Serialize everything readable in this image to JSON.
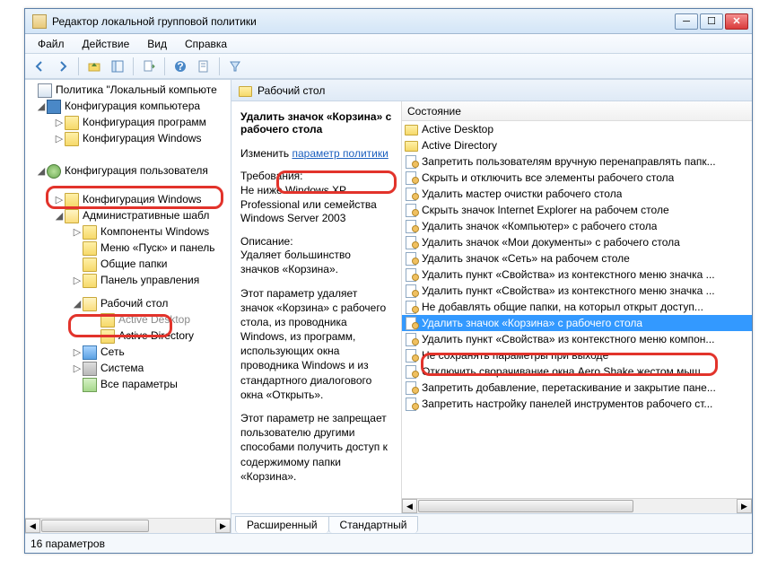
{
  "window": {
    "title": "Редактор локальной групповой политики"
  },
  "menu": {
    "file": "Файл",
    "action": "Действие",
    "view": "Вид",
    "help": "Справка"
  },
  "tree": {
    "root": "Политика \"Локальный компьюте",
    "compConfig": "Конфигурация компьютера",
    "compProg": "Конфигурация программ",
    "compWin": "Конфигурация Windows",
    "userConfig": "Конфигурация пользователя",
    "userWinCfg": "Конфигурация Windows",
    "adminTmpl": "Административные шабл",
    "compWinNode": "Компоненты Windows",
    "startMenu": "Меню «Пуск» и панель",
    "sharedFolders": "Общие папки",
    "controlPanel": "Панель управления",
    "desktop": "Рабочий стол",
    "activeDesktop": "Active Desktop",
    "activeDirectory": "Active Directory",
    "network": "Сеть",
    "system": "Система",
    "allSettings": "Все параметры"
  },
  "rightHeader": "Рабочий стол",
  "desc": {
    "title": "Удалить значок «Корзина» с рабочего стола",
    "editLabel": "Изменить",
    "editLink": "параметр политики",
    "reqLabel": "Требования:",
    "reqText": "Не ниже Windows XP Professional или семейства Windows Server 2003",
    "descLabel": "Описание:",
    "descShort": "Удаляет большинство значков «Корзина».",
    "descLong": "Этот параметр удаляет значок «Корзина» с рабочего стола, из проводника Windows, из программ, использующих окна проводника Windows и из стандартного диалогового окна «Открыть».",
    "descNote": "Этот параметр не запрещает пользователю другими способами получить доступ к содержимому папки «Корзина»."
  },
  "listHeader": "Состояние",
  "listFolders": [
    "Active Desktop",
    "Active Directory"
  ],
  "listItems": [
    "Запретить пользователям вручную перенаправлять папк...",
    "Скрыть и отключить все элементы рабочего стола",
    "Удалить мастер очистки рабочего стола",
    "Скрыть значок Internet Explorer на рабочем столе",
    "Удалить значок «Компьютер» с рабочего стола",
    "Удалить значок «Мои документы» с рабочего стола",
    "Удалить значок «Сеть» на рабочем столе",
    "Удалить пункт «Свойства» из контекстного меню значка ...",
    "Удалить пункт «Свойства» из контекстного меню значка ...",
    "Не добавлять общие папки, на которыл открыт доступ...",
    "Удалить значок «Корзина» с рабочего стола",
    "Удалить пункт «Свойства» из контекстного меню компон...",
    "Не сохранять параметры при выходе",
    "Отключить сворачивание окна Aero Shake жестом мыш...",
    "Запретить добавление, перетаскивание и закрытие пане...",
    "Запретить настройку панелей инструментов рабочего ст..."
  ],
  "selectedIndex": 10,
  "tabs": {
    "extended": "Расширенный",
    "standard": "Стандартный"
  },
  "status": "16 параметров"
}
